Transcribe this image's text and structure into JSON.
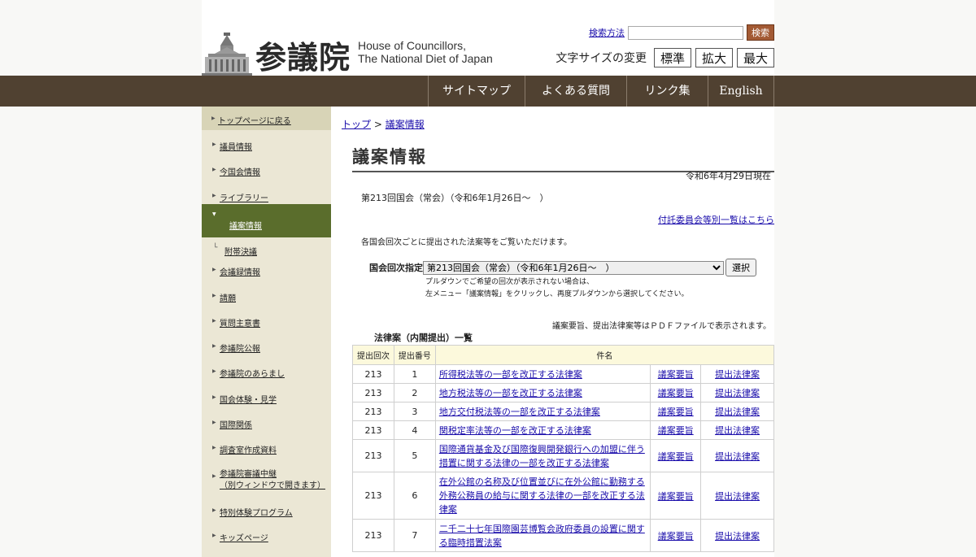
{
  "header": {
    "logo_kanji": "参議院",
    "logo_en_line1": "House of Councillors,",
    "logo_en_line2": "The National Diet of Japan",
    "search_help_link": "検索方法",
    "search_placeholder": "",
    "search_button": "検索",
    "font_size_label": "文字サイズの変更",
    "font_size_buttons": [
      "標準",
      "拡大",
      "最大"
    ]
  },
  "nav": {
    "items": [
      "サイトマップ",
      "よくある質問",
      "リンク集",
      "English"
    ]
  },
  "sidebar": {
    "items": [
      {
        "label": "トップページに戻る"
      },
      {
        "label": "議員情報"
      },
      {
        "label": "今国会情報"
      },
      {
        "label": "ライブラリー"
      },
      {
        "label": "議案情報"
      },
      {
        "label": "附帯決議"
      },
      {
        "label": "会議録情報"
      },
      {
        "label": "請願"
      },
      {
        "label": "質問主意書"
      },
      {
        "label": "参議院公報"
      },
      {
        "label": "参議院のあらまし"
      },
      {
        "label": "国会体験・見学"
      },
      {
        "label": "国際関係"
      },
      {
        "label": "調査室作成資料"
      },
      {
        "label": "参議院審議中継",
        "label2": "（別ウィンドウで開きます）"
      },
      {
        "label": "特別体験プログラム"
      },
      {
        "label": "キッズページ"
      }
    ]
  },
  "main": {
    "breadcrumb_top": "トップ",
    "breadcrumb_sep": ">",
    "breadcrumb_current": "議案情報",
    "title": "議案情報",
    "as_of": "令和6年4月29日現在",
    "session": "第213回国会（常会）（令和6年1月26日～　）",
    "committee_link": "付託委員会等別一覧はこちら",
    "intro": "各国会回次ごとに提出された法案等をご覧いただけます。",
    "select_label": "国会回次指定",
    "select_value": "第213回国会（常会）（令和6年1月26日～　）",
    "select_button": "選択",
    "note_line1": "プルダウンでご希望の回次が表示されない場合は、",
    "note_line2": "左メニュー「議案情報」をクリックし、再度プルダウンから選択してください。",
    "pdf_note": "議案要旨、提出法律案等はＰＤＦファイルで表示されます。",
    "table_title": "法律案（内閣提出）一覧",
    "table": {
      "headers": [
        "提出回次",
        "提出番号",
        "件名"
      ],
      "rows": [
        {
          "session": "213",
          "number": "1",
          "name": "所得税法等の一部を改正する法律案",
          "summary": "議案要旨",
          "bill": "提出法律案"
        },
        {
          "session": "213",
          "number": "2",
          "name": "地方税法等の一部を改正する法律案",
          "summary": "議案要旨",
          "bill": "提出法律案"
        },
        {
          "session": "213",
          "number": "3",
          "name": "地方交付税法等の一部を改正する法律案",
          "summary": "議案要旨",
          "bill": "提出法律案"
        },
        {
          "session": "213",
          "number": "4",
          "name": "関税定率法等の一部を改正する法律案",
          "summary": "議案要旨",
          "bill": "提出法律案"
        },
        {
          "session": "213",
          "number": "5",
          "name": "国際通貨基金及び国際復興開発銀行への加盟に伴う措置に関する法律の一部を改正する法律案",
          "summary": "議案要旨",
          "bill": "提出法律案"
        },
        {
          "session": "213",
          "number": "6",
          "name": "在外公館の名称及び位置並びに在外公館に勤務する外務公務員の給与に関する法律の一部を改正する法律案",
          "summary": "議案要旨",
          "bill": "提出法律案"
        },
        {
          "session": "213",
          "number": "7",
          "name": "二千二十七年国際園芸博覧会政府委員の設置に関する臨時措置法案",
          "summary": "議案要旨",
          "bill": "提出法律案"
        }
      ]
    }
  }
}
